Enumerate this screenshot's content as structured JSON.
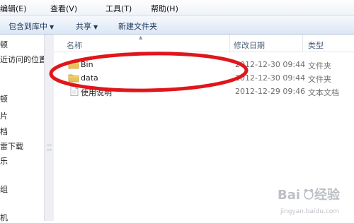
{
  "menubar": {
    "items": [
      "编辑(E)",
      "查看(V)",
      "工具(T)",
      "帮助(H)"
    ]
  },
  "toolbar": {
    "include_library": "包含到库中",
    "share": "共享",
    "new_folder": "新建文件夹"
  },
  "nav": {
    "items": [
      "顿",
      "近访问的位置",
      "顿",
      "片",
      "档",
      "雷下载",
      "乐",
      "组",
      "机"
    ]
  },
  "columns": {
    "name": "名称",
    "date": "修改日期",
    "type": "类型"
  },
  "files": [
    {
      "name": "Bin",
      "date": "2012-12-30 09:44",
      "type": "文件夹",
      "icon": "folder-icon"
    },
    {
      "name": "data",
      "date": "2012-12-30 09:44",
      "type": "文件夹",
      "icon": "folder-icon"
    },
    {
      "name": "使用说明",
      "date": "2012-12-29 09:46",
      "type": "文本文档",
      "icon": "text-file-icon"
    }
  ],
  "colors": {
    "annotation": "#e0161b",
    "folder": "#e8c35a",
    "watermark": "#9aa0a6"
  }
}
